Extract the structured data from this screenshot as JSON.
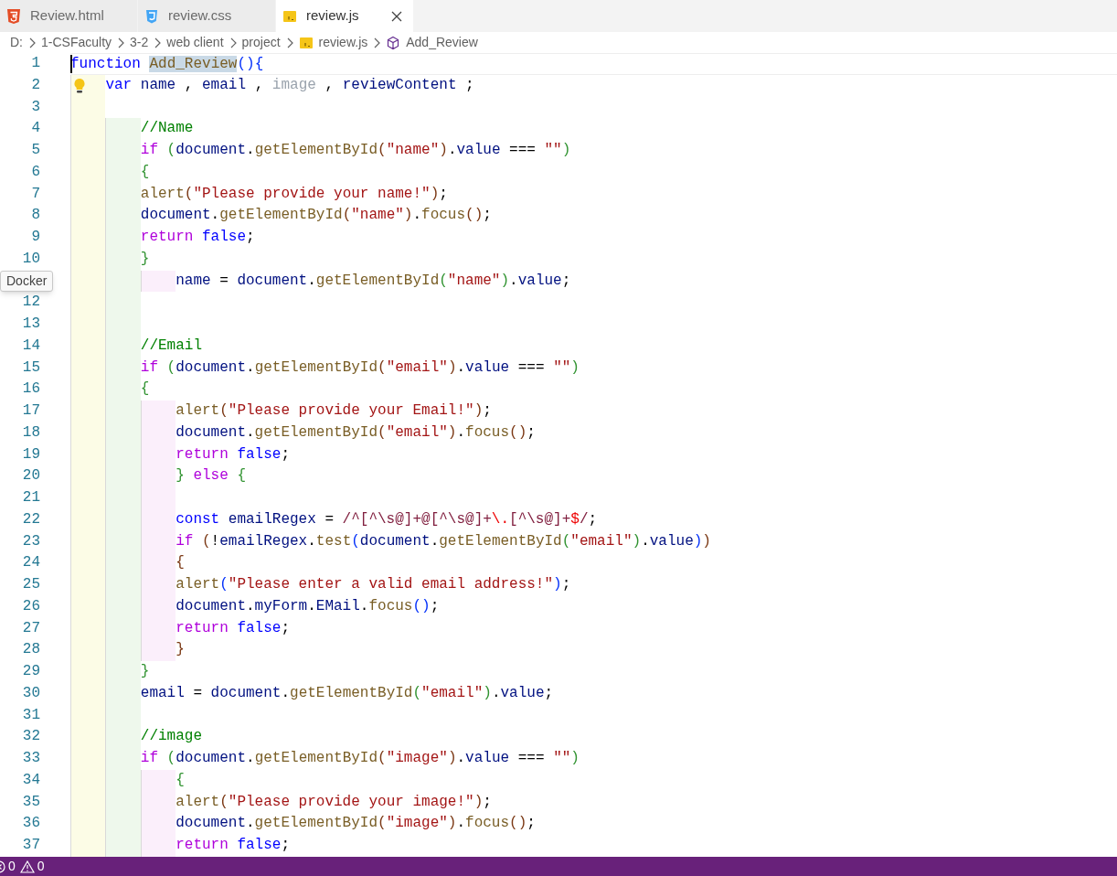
{
  "tabs": [
    {
      "label": "Review.html",
      "kind": "html",
      "selected": false
    },
    {
      "label": "review.css",
      "kind": "css",
      "selected": false
    },
    {
      "label": "review.js",
      "kind": "js",
      "selected": true
    }
  ],
  "breadcrumbs": [
    {
      "label": "D:",
      "kind": "folder"
    },
    {
      "label": "1-CSFaculty",
      "kind": "folder"
    },
    {
      "label": "3-2",
      "kind": "folder"
    },
    {
      "label": "web client",
      "kind": "folder"
    },
    {
      "label": "project",
      "kind": "folder"
    },
    {
      "label": "review.js",
      "kind": "file"
    },
    {
      "label": "Add_Review",
      "kind": "symbol"
    }
  ],
  "editor": {
    "lines": [
      {
        "number": "1",
        "current": true,
        "tokens": [
          {
            "text": "function ",
            "kind": "kw"
          },
          {
            "text": "Add_Review",
            "kind": "fn",
            "highlighted": true
          },
          {
            "text": "(){",
            "kind": "b1"
          }
        ]
      },
      {
        "number": "2",
        "lightbulb": true,
        "tokens": [
          {
            "text": "    var ",
            "kind": "kw"
          },
          {
            "text": "name",
            "kind": "var"
          },
          {
            "text": " , ",
            "kind": "p"
          },
          {
            "text": "email",
            "kind": "var"
          },
          {
            "text": " , ",
            "kind": "p"
          },
          {
            "text": "image",
            "kind": "unused"
          },
          {
            "text": " , ",
            "kind": "p"
          },
          {
            "text": "reviewContent",
            "kind": "var"
          },
          {
            "text": " ;",
            "kind": "p"
          }
        ]
      },
      {
        "number": "3"
      },
      {
        "number": "4",
        "tokens": [
          {
            "text": "        //Name",
            "kind": "cmt"
          }
        ]
      },
      {
        "number": "5",
        "tokens": [
          {
            "text": "        if ",
            "kind": "ctl"
          },
          {
            "text": "(",
            "kind": "b2"
          },
          {
            "text": "document",
            "kind": "var"
          },
          {
            "text": ".",
            "kind": "p"
          },
          {
            "text": "getElementById",
            "kind": "fn"
          },
          {
            "text": "(",
            "kind": "b3"
          },
          {
            "text": "\"name\"",
            "kind": "str"
          },
          {
            "text": ")",
            "kind": "b3"
          },
          {
            "text": ".",
            "kind": "p"
          },
          {
            "text": "value",
            "kind": "var"
          },
          {
            "text": " === ",
            "kind": "p"
          },
          {
            "text": "\"\"",
            "kind": "str"
          },
          {
            "text": ")",
            "kind": "b2"
          }
        ]
      },
      {
        "number": "6",
        "tokens": [
          {
            "text": "        {",
            "kind": "b2"
          }
        ]
      },
      {
        "number": "7",
        "tokens": [
          {
            "text": "        alert",
            "kind": "fn"
          },
          {
            "text": "(",
            "kind": "b3"
          },
          {
            "text": "\"Please provide your name!\"",
            "kind": "str"
          },
          {
            "text": ")",
            "kind": "b3"
          },
          {
            "text": ";",
            "kind": "p"
          }
        ]
      },
      {
        "number": "8",
        "tokens": [
          {
            "text": "        document",
            "kind": "var"
          },
          {
            "text": ".",
            "kind": "p"
          },
          {
            "text": "getElementById",
            "kind": "fn"
          },
          {
            "text": "(",
            "kind": "b3"
          },
          {
            "text": "\"name\"",
            "kind": "str"
          },
          {
            "text": ")",
            "kind": "b3"
          },
          {
            "text": ".",
            "kind": "p"
          },
          {
            "text": "focus",
            "kind": "fn"
          },
          {
            "text": "()",
            "kind": "b3"
          },
          {
            "text": ";",
            "kind": "p"
          }
        ]
      },
      {
        "number": "9",
        "tokens": [
          {
            "text": "        return ",
            "kind": "ctl"
          },
          {
            "text": "false",
            "kind": "kw"
          },
          {
            "text": ";",
            "kind": "p"
          }
        ]
      },
      {
        "number": "10",
        "tokens": [
          {
            "text": "        }",
            "kind": "b2"
          }
        ]
      },
      {
        "tokens": [
          {
            "text": "            name",
            "kind": "var"
          },
          {
            "text": " = ",
            "kind": "p"
          },
          {
            "text": "document",
            "kind": "var"
          },
          {
            "text": ".",
            "kind": "p"
          },
          {
            "text": "getElementById",
            "kind": "fn"
          },
          {
            "text": "(",
            "kind": "b2"
          },
          {
            "text": "\"name\"",
            "kind": "str"
          },
          {
            "text": ")",
            "kind": "b2"
          },
          {
            "text": ".",
            "kind": "p"
          },
          {
            "text": "value",
            "kind": "var"
          },
          {
            "text": ";",
            "kind": "p"
          }
        ]
      },
      {
        "number": "12"
      },
      {
        "number": "13"
      },
      {
        "number": "14",
        "tokens": [
          {
            "text": "        //Email",
            "kind": "cmt"
          }
        ]
      },
      {
        "number": "15",
        "tokens": [
          {
            "text": "        if ",
            "kind": "ctl"
          },
          {
            "text": "(",
            "kind": "b2"
          },
          {
            "text": "document",
            "kind": "var"
          },
          {
            "text": ".",
            "kind": "p"
          },
          {
            "text": "getElementById",
            "kind": "fn"
          },
          {
            "text": "(",
            "kind": "b3"
          },
          {
            "text": "\"email\"",
            "kind": "str"
          },
          {
            "text": ")",
            "kind": "b3"
          },
          {
            "text": ".",
            "kind": "p"
          },
          {
            "text": "value",
            "kind": "var"
          },
          {
            "text": " === ",
            "kind": "p"
          },
          {
            "text": "\"\"",
            "kind": "str"
          },
          {
            "text": ")",
            "kind": "b2"
          }
        ]
      },
      {
        "number": "16",
        "tokens": [
          {
            "text": "        {",
            "kind": "b2"
          }
        ]
      },
      {
        "number": "17",
        "tokens": [
          {
            "text": "            alert",
            "kind": "fn"
          },
          {
            "text": "(",
            "kind": "b3"
          },
          {
            "text": "\"Please provide your Email!\"",
            "kind": "str"
          },
          {
            "text": ")",
            "kind": "b3"
          },
          {
            "text": ";",
            "kind": "p"
          }
        ]
      },
      {
        "number": "18",
        "tokens": [
          {
            "text": "            document",
            "kind": "var"
          },
          {
            "text": ".",
            "kind": "p"
          },
          {
            "text": "getElementById",
            "kind": "fn"
          },
          {
            "text": "(",
            "kind": "b3"
          },
          {
            "text": "\"email\"",
            "kind": "str"
          },
          {
            "text": ")",
            "kind": "b3"
          },
          {
            "text": ".",
            "kind": "p"
          },
          {
            "text": "focus",
            "kind": "fn"
          },
          {
            "text": "()",
            "kind": "b3"
          },
          {
            "text": ";",
            "kind": "p"
          }
        ]
      },
      {
        "number": "19",
        "tokens": [
          {
            "text": "            return ",
            "kind": "ctl"
          },
          {
            "text": "false",
            "kind": "kw"
          },
          {
            "text": ";",
            "kind": "p"
          }
        ]
      },
      {
        "number": "20",
        "tokens": [
          {
            "text": "            } ",
            "kind": "b2"
          },
          {
            "text": "else ",
            "kind": "ctl"
          },
          {
            "text": "{",
            "kind": "b2"
          }
        ]
      },
      {
        "number": "21"
      },
      {
        "number": "22",
        "tokens": [
          {
            "text": "            const ",
            "kind": "kw"
          },
          {
            "text": "emailRegex",
            "kind": "var"
          },
          {
            "text": " = ",
            "kind": "p"
          },
          {
            "text": "/^[^\\s@]+@[^\\s@]+",
            "kind": "rx"
          },
          {
            "text": "\\.",
            "kind": "rxe"
          },
          {
            "text": "[^\\s@]+",
            "kind": "rx"
          },
          {
            "text": "$",
            "kind": "rxe"
          },
          {
            "text": "/",
            "kind": "rx"
          },
          {
            "text": ";",
            "kind": "p"
          }
        ]
      },
      {
        "number": "23",
        "tokens": [
          {
            "text": "            if ",
            "kind": "ctl"
          },
          {
            "text": "(",
            "kind": "b3"
          },
          {
            "text": "!",
            "kind": "p"
          },
          {
            "text": "emailRegex",
            "kind": "var"
          },
          {
            "text": ".",
            "kind": "p"
          },
          {
            "text": "test",
            "kind": "fn"
          },
          {
            "text": "(",
            "kind": "b1"
          },
          {
            "text": "document",
            "kind": "var"
          },
          {
            "text": ".",
            "kind": "p"
          },
          {
            "text": "getElementById",
            "kind": "fn"
          },
          {
            "text": "(",
            "kind": "b2"
          },
          {
            "text": "\"email\"",
            "kind": "str"
          },
          {
            "text": ")",
            "kind": "b2"
          },
          {
            "text": ".",
            "kind": "p"
          },
          {
            "text": "value",
            "kind": "var"
          },
          {
            "text": ")",
            "kind": "b1"
          },
          {
            "text": ")",
            "kind": "b3"
          }
        ]
      },
      {
        "number": "24",
        "tokens": [
          {
            "text": "            {",
            "kind": "b3"
          }
        ]
      },
      {
        "number": "25",
        "tokens": [
          {
            "text": "            alert",
            "kind": "fn"
          },
          {
            "text": "(",
            "kind": "b1"
          },
          {
            "text": "\"Please enter a valid email address!\"",
            "kind": "str"
          },
          {
            "text": ")",
            "kind": "b1"
          },
          {
            "text": ";",
            "kind": "p"
          }
        ]
      },
      {
        "number": "26",
        "tokens": [
          {
            "text": "            document",
            "kind": "var"
          },
          {
            "text": ".",
            "kind": "p"
          },
          {
            "text": "myForm",
            "kind": "var"
          },
          {
            "text": ".",
            "kind": "p"
          },
          {
            "text": "EMail",
            "kind": "var"
          },
          {
            "text": ".",
            "kind": "p"
          },
          {
            "text": "focus",
            "kind": "fn"
          },
          {
            "text": "()",
            "kind": "b1"
          },
          {
            "text": ";",
            "kind": "p"
          }
        ]
      },
      {
        "number": "27",
        "tokens": [
          {
            "text": "            return ",
            "kind": "ctl"
          },
          {
            "text": "false",
            "kind": "kw"
          },
          {
            "text": ";",
            "kind": "p"
          }
        ]
      },
      {
        "number": "28",
        "tokens": [
          {
            "text": "            }",
            "kind": "b3"
          }
        ]
      },
      {
        "number": "29",
        "tokens": [
          {
            "text": "        }",
            "kind": "b2"
          }
        ]
      },
      {
        "number": "30",
        "tokens": [
          {
            "text": "        email",
            "kind": "var"
          },
          {
            "text": " = ",
            "kind": "p"
          },
          {
            "text": "document",
            "kind": "var"
          },
          {
            "text": ".",
            "kind": "p"
          },
          {
            "text": "getElementById",
            "kind": "fn"
          },
          {
            "text": "(",
            "kind": "b2"
          },
          {
            "text": "\"email\"",
            "kind": "str"
          },
          {
            "text": ")",
            "kind": "b2"
          },
          {
            "text": ".",
            "kind": "p"
          },
          {
            "text": "value",
            "kind": "var"
          },
          {
            "text": ";",
            "kind": "p"
          }
        ]
      },
      {
        "number": "31"
      },
      {
        "number": "32",
        "tokens": [
          {
            "text": "        //image",
            "kind": "cmt"
          }
        ]
      },
      {
        "number": "33",
        "tokens": [
          {
            "text": "        if ",
            "kind": "ctl"
          },
          {
            "text": "(",
            "kind": "b2"
          },
          {
            "text": "document",
            "kind": "var"
          },
          {
            "text": ".",
            "kind": "p"
          },
          {
            "text": "getElementById",
            "kind": "fn"
          },
          {
            "text": "(",
            "kind": "b3"
          },
          {
            "text": "\"image\"",
            "kind": "str"
          },
          {
            "text": ")",
            "kind": "b3"
          },
          {
            "text": ".",
            "kind": "p"
          },
          {
            "text": "value",
            "kind": "var"
          },
          {
            "text": " === ",
            "kind": "p"
          },
          {
            "text": "\"\"",
            "kind": "str"
          },
          {
            "text": ")",
            "kind": "b2"
          }
        ]
      },
      {
        "number": "34",
        "tokens": [
          {
            "text": "            {",
            "kind": "b2"
          }
        ]
      },
      {
        "number": "35",
        "tokens": [
          {
            "text": "            alert",
            "kind": "fn"
          },
          {
            "text": "(",
            "kind": "b3"
          },
          {
            "text": "\"Please provide your image!\"",
            "kind": "str"
          },
          {
            "text": ")",
            "kind": "b3"
          },
          {
            "text": ";",
            "kind": "p"
          }
        ]
      },
      {
        "number": "36",
        "tokens": [
          {
            "text": "            document",
            "kind": "var"
          },
          {
            "text": ".",
            "kind": "p"
          },
          {
            "text": "getElementById",
            "kind": "fn"
          },
          {
            "text": "(",
            "kind": "b3"
          },
          {
            "text": "\"image\"",
            "kind": "str"
          },
          {
            "text": ")",
            "kind": "b3"
          },
          {
            "text": ".",
            "kind": "p"
          },
          {
            "text": "focus",
            "kind": "fn"
          },
          {
            "text": "()",
            "kind": "b3"
          },
          {
            "text": ";",
            "kind": "p"
          }
        ]
      },
      {
        "number": "37",
        "tokens": [
          {
            "text": "            return ",
            "kind": "ctl"
          },
          {
            "text": "false",
            "kind": "kw"
          },
          {
            "text": ";",
            "kind": "p"
          }
        ]
      }
    ]
  },
  "tooltip": {
    "text": "Docker"
  },
  "status_bar": {
    "errors": "0",
    "warnings": "0"
  }
}
